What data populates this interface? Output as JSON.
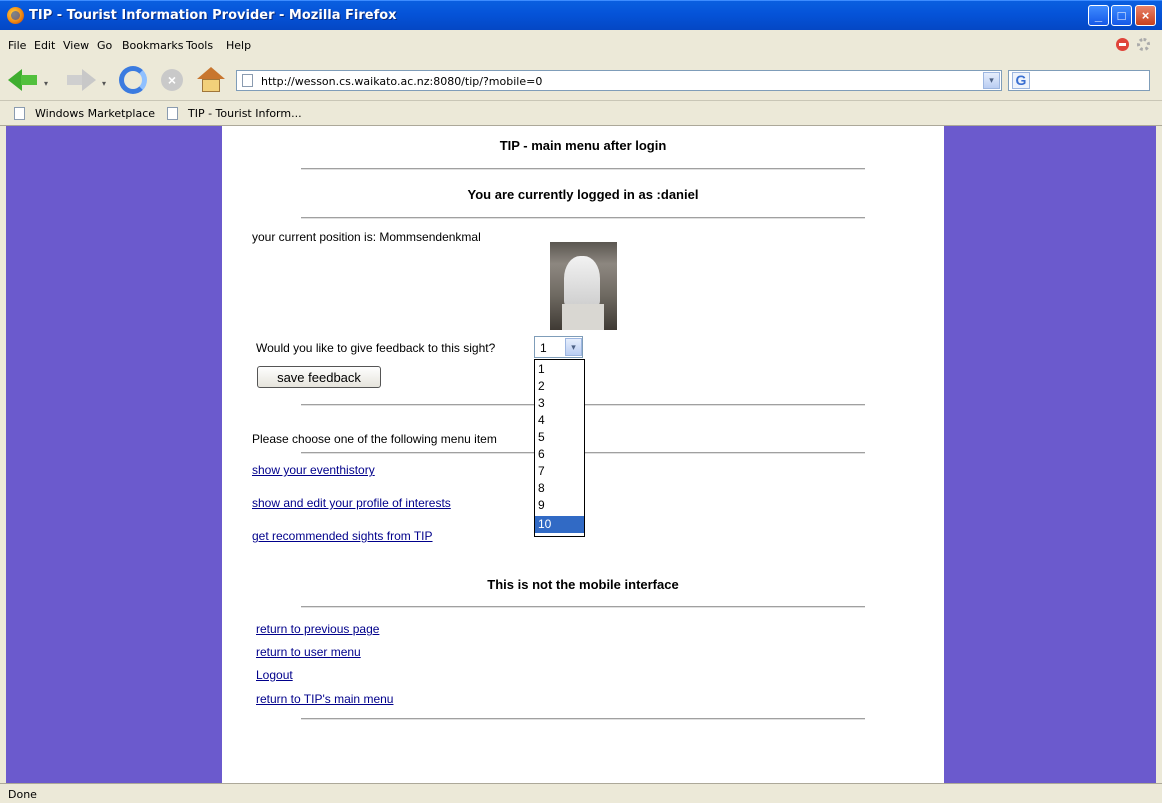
{
  "window": {
    "title": "TIP - Tourist Information Provider - Mozilla Firefox",
    "buttons": {
      "minimize": "_",
      "maximize": "□",
      "close": "×"
    }
  },
  "menu": [
    "File",
    "Edit",
    "View",
    "Go",
    "Bookmarks",
    "Tools",
    "Help"
  ],
  "toolbar": {
    "url": "http://wesson.cs.waikato.ac.nz:8080/tip/?mobile=0",
    "search_icon_letter": "G",
    "stop_glyph": "×",
    "dropdown_glyph": "▾"
  },
  "bookmarks": [
    "Windows Marketplace",
    "TIP - Tourist Inform..."
  ],
  "page": {
    "heading_main": "TIP - main menu after login",
    "heading_logged": "You are currently logged in as :daniel",
    "position_text": "your current position is: Mommsendenkmal",
    "feedback_question": "Would you like to give feedback to this sight?",
    "feedback_selected": "1",
    "feedback_options": [
      "1",
      "2",
      "3",
      "4",
      "5",
      "6",
      "7",
      "8",
      "9",
      "10"
    ],
    "feedback_highlighted": "10",
    "save_button": "save feedback",
    "choose_text": "Please choose one of the following menu item",
    "menu_links": [
      "show your eventhistory",
      "show and edit your profile of interests",
      "get recommended sights from TIP"
    ],
    "not_mobile": "This is not the mobile interface",
    "nav_links": [
      "return to previous page",
      "return to user menu",
      "Logout",
      "return to TIP's main menu"
    ]
  },
  "colors": {
    "background_purple": "#6b5acd",
    "link": "#00008b",
    "titlebar": "#0553d8",
    "selection": "#316ac5"
  },
  "status": "Done"
}
